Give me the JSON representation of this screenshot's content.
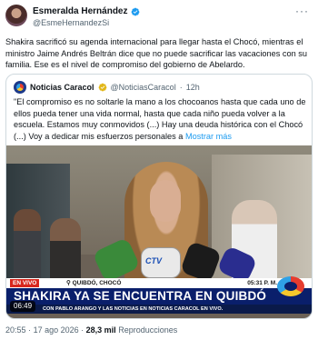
{
  "author": {
    "name": "Esmeralda Hernández",
    "handle": "@EsmeHernandezSi",
    "more_icon": "more-horizontal-icon",
    "verified_color": "#1d9bf0"
  },
  "tweet": {
    "text": "Shakira sacrificó su agenda internacional para llegar hasta el Chocó, mientras el ministro Jaime Andrés Beltrán dice que no puede sacrificar las vacaciones con su familia. Ese es el nivel de compromiso del gobierno de Abelardo."
  },
  "quote": {
    "name": "Noticias Caracol",
    "handle": "@NoticiasCaracol",
    "separator": "·",
    "time": "12h",
    "text": "\"El compromiso es no soltarle la mano a los chocoanos hasta que cada uno de ellos pueda tener una vida normal, hasta que cada niño pueda volver a la escuela. Estamos muy conmovidos (...) Hay una deuda histórica con el Chocó (...) Voy a dedicar mis esfuerzos personales a",
    "show_more": "Mostrar más"
  },
  "video": {
    "live_label": "EN VIVO",
    "location": "QUIBDÓ, CHOCÓ",
    "clock": "05:31 P. M.",
    "headline": "SHAKIRA YA SE ENCUENTRA EN QUIBDÓ",
    "ticker": "CON PABLO ARANGO Y LAS NOTICIAS EN NOTICIAS CARACOL EN VIVO.",
    "duration": "06:49",
    "mic_brand": "CTV"
  },
  "meta": {
    "time": "20:55",
    "date": "17 ago 2026",
    "dot": "·",
    "views": "28,3 mil",
    "views_label": "Reproducciones"
  }
}
